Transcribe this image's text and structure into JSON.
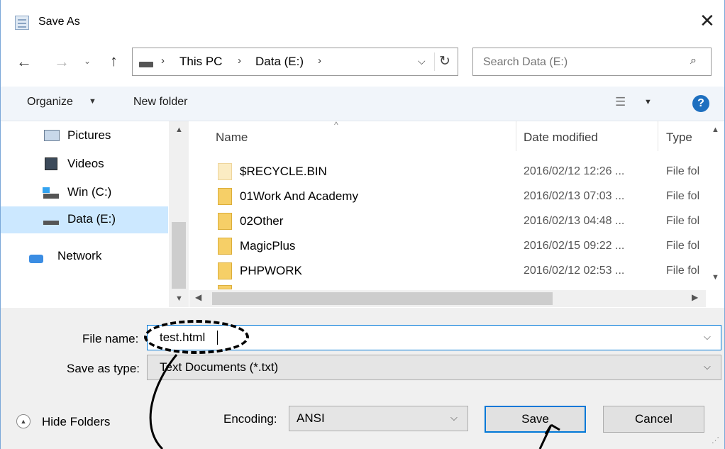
{
  "window": {
    "title": "Save As"
  },
  "nav": {
    "breadcrumb": [
      "This PC",
      "Data (E:)"
    ],
    "search_placeholder": "Search Data (E:)"
  },
  "toolbar": {
    "organize": "Organize",
    "new_folder": "New folder"
  },
  "sidebar": {
    "items": [
      {
        "label": "Pictures",
        "icon": "pictures-icon"
      },
      {
        "label": "Videos",
        "icon": "videos-icon"
      },
      {
        "label": "Win (C:)",
        "icon": "windows-drive-icon"
      },
      {
        "label": "Data (E:)",
        "icon": "drive-icon",
        "selected": true
      },
      {
        "label": "Network",
        "icon": "network-icon"
      }
    ]
  },
  "file_list": {
    "columns": [
      "Name",
      "Date modified",
      "Type"
    ],
    "rows": [
      {
        "name": "$RECYCLE.BIN",
        "date": "2016/02/12 12:26 ...",
        "type": "File fol"
      },
      {
        "name": "01Work And Academy",
        "date": "2016/02/13 07:03 ...",
        "type": "File fol"
      },
      {
        "name": "02Other",
        "date": "2016/02/13 04:48 ...",
        "type": "File fol"
      },
      {
        "name": "MagicPlus",
        "date": "2016/02/15 09:22 ...",
        "type": "File fol"
      },
      {
        "name": "PHPWORK",
        "date": "2016/02/12 02:53 ...",
        "type": "File fol"
      }
    ]
  },
  "form": {
    "file_name_label": "File name:",
    "file_name_value": "test.html",
    "save_type_label": "Save as type:",
    "save_type_value": "Text Documents (*.txt)",
    "encoding_label": "Encoding:",
    "encoding_value": "ANSI"
  },
  "footer": {
    "hide_folders": "Hide Folders",
    "save": "Save",
    "cancel": "Cancel"
  },
  "colors": {
    "selection": "#cce8ff",
    "accent": "#0078d7",
    "help": "#1e6fbf",
    "folder": "#f6cf67"
  }
}
